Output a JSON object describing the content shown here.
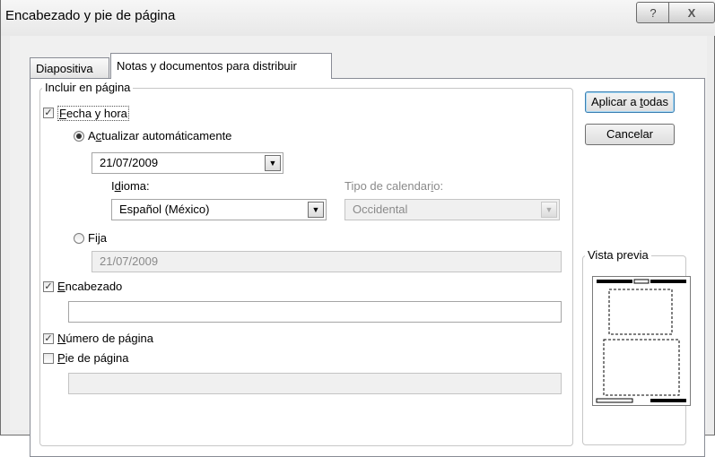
{
  "window": {
    "title": "Encabezado y pie de página",
    "help_label": "?",
    "close_label": "X"
  },
  "tabs": [
    {
      "label": "Diapositiva",
      "selected": false
    },
    {
      "label": "Notas y documentos para distribuir",
      "selected": true
    }
  ],
  "include_group": {
    "legend": "Incluir en página",
    "date_time": {
      "label_pre": "",
      "label_u": "F",
      "label_post": "echa y hora",
      "checked": true
    },
    "auto_update": {
      "label_pre": "A",
      "label_u": "c",
      "label_post": "tualizar automáticamente",
      "selected": true
    },
    "auto_date_value": "21/07/2009",
    "language": {
      "label_pre": "I",
      "label_u": "d",
      "label_post": "ioma:",
      "value": "Español (México)"
    },
    "calendar": {
      "label_pre": "Tipo de calendar",
      "label_u": "i",
      "label_post": "o:",
      "value": "Occidental"
    },
    "fixed": {
      "label_pre": "Fi",
      "label_u": "j",
      "label_post": "a",
      "selected": false,
      "value": "21/07/2009"
    },
    "header": {
      "label_pre": "",
      "label_u": "E",
      "label_post": "ncabezado",
      "checked": true,
      "value": ""
    },
    "page_number": {
      "label_pre": "",
      "label_u": "N",
      "label_post": "úmero de página",
      "checked": true
    },
    "footer": {
      "label_pre": "",
      "label_u": "P",
      "label_post": "ie de página",
      "checked": false,
      "value": ""
    }
  },
  "buttons": {
    "apply_all_pre": "Aplicar a ",
    "apply_all_u": "t",
    "apply_all_post": "odas",
    "cancel": "Cancelar"
  },
  "preview": {
    "legend": "Vista previa"
  },
  "icons": {
    "check": "checkmark-icon",
    "dropdown": "chevron-down-icon"
  }
}
